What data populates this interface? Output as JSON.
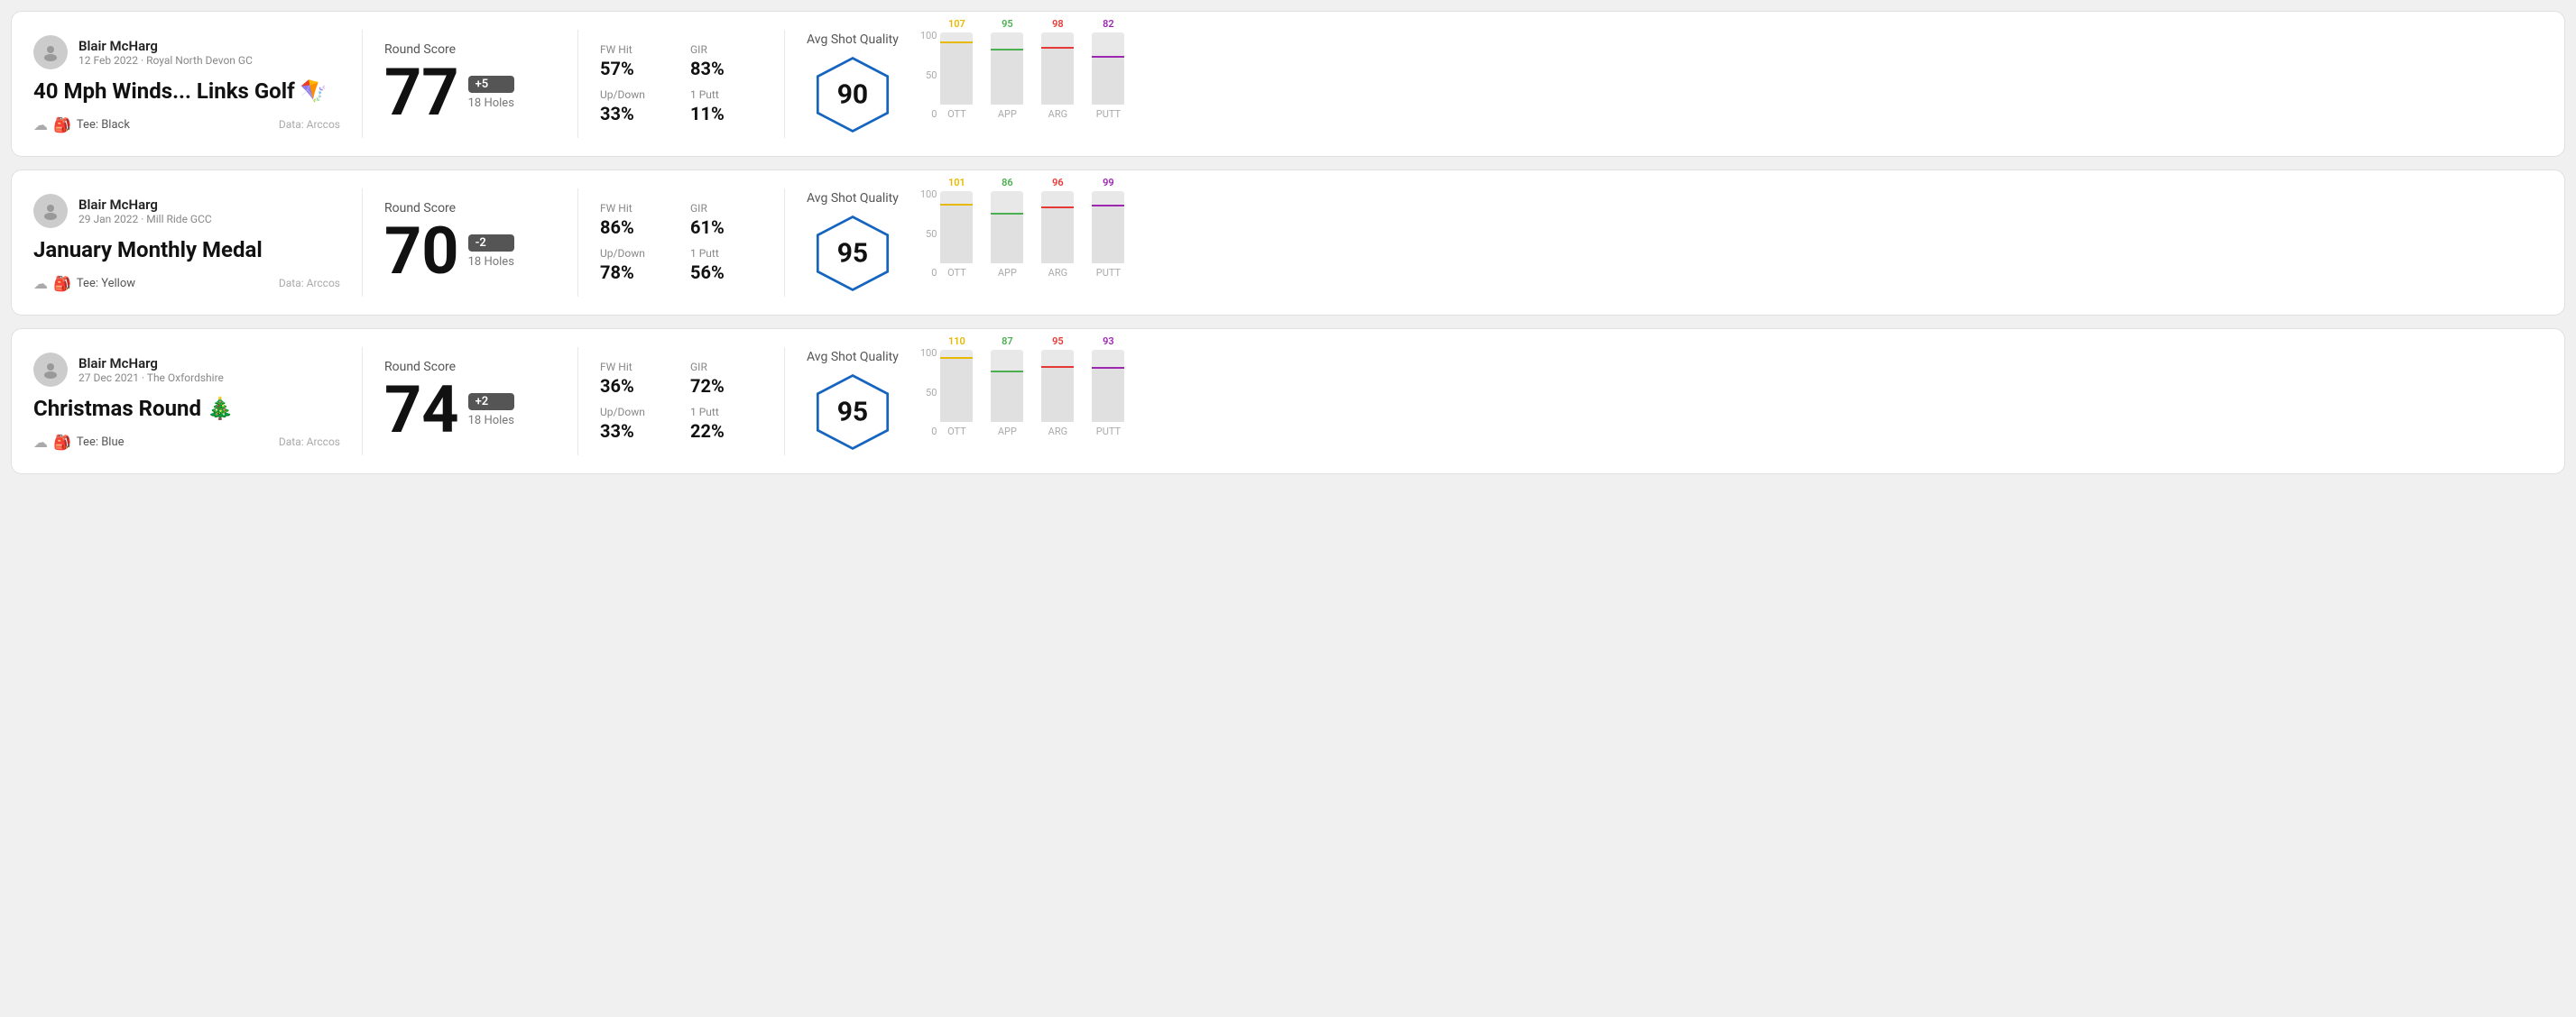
{
  "cards": [
    {
      "id": "card1",
      "user": {
        "name": "Blair McHarg",
        "date": "12 Feb 2022 · Royal North Devon GC"
      },
      "title": "40 Mph Winds... Links Golf 🪁",
      "tee": "Tee: Black",
      "data_source": "Data: Arccos",
      "score": {
        "label": "Round Score",
        "number": "77",
        "badge": "+5",
        "badge_type": "over",
        "holes": "18 Holes"
      },
      "stats": [
        {
          "name": "FW Hit",
          "value": "57%"
        },
        {
          "name": "GIR",
          "value": "83%"
        },
        {
          "name": "Up/Down",
          "value": "33%"
        },
        {
          "name": "1 Putt",
          "value": "11%"
        }
      ],
      "quality": {
        "label": "Avg Shot Quality",
        "score": "90"
      },
      "chart": {
        "bars": [
          {
            "label": "OTT",
            "value": 107,
            "color": "#e6b800",
            "pct": 85
          },
          {
            "label": "APP",
            "value": 95,
            "color": "#4caf50",
            "pct": 75
          },
          {
            "label": "ARG",
            "value": 98,
            "color": "#e53935",
            "pct": 78
          },
          {
            "label": "PUTT",
            "value": 82,
            "color": "#9c27b0",
            "pct": 65
          }
        ]
      }
    },
    {
      "id": "card2",
      "user": {
        "name": "Blair McHarg",
        "date": "29 Jan 2022 · Mill Ride GCC"
      },
      "title": "January Monthly Medal",
      "tee": "Tee: Yellow",
      "data_source": "Data: Arccos",
      "score": {
        "label": "Round Score",
        "number": "70",
        "badge": "-2",
        "badge_type": "under",
        "holes": "18 Holes"
      },
      "stats": [
        {
          "name": "FW Hit",
          "value": "86%"
        },
        {
          "name": "GIR",
          "value": "61%"
        },
        {
          "name": "Up/Down",
          "value": "78%"
        },
        {
          "name": "1 Putt",
          "value": "56%"
        }
      ],
      "quality": {
        "label": "Avg Shot Quality",
        "score": "95"
      },
      "chart": {
        "bars": [
          {
            "label": "OTT",
            "value": 101,
            "color": "#e6b800",
            "pct": 80
          },
          {
            "label": "APP",
            "value": 86,
            "color": "#4caf50",
            "pct": 68
          },
          {
            "label": "ARG",
            "value": 96,
            "color": "#e53935",
            "pct": 76
          },
          {
            "label": "PUTT",
            "value": 99,
            "color": "#9c27b0",
            "pct": 79
          }
        ]
      }
    },
    {
      "id": "card3",
      "user": {
        "name": "Blair McHarg",
        "date": "27 Dec 2021 · The Oxfordshire"
      },
      "title": "Christmas Round 🎄",
      "tee": "Tee: Blue",
      "data_source": "Data: Arccos",
      "score": {
        "label": "Round Score",
        "number": "74",
        "badge": "+2",
        "badge_type": "over",
        "holes": "18 Holes"
      },
      "stats": [
        {
          "name": "FW Hit",
          "value": "36%"
        },
        {
          "name": "GIR",
          "value": "72%"
        },
        {
          "name": "Up/Down",
          "value": "33%"
        },
        {
          "name": "1 Putt",
          "value": "22%"
        }
      ],
      "quality": {
        "label": "Avg Shot Quality",
        "score": "95"
      },
      "chart": {
        "bars": [
          {
            "label": "OTT",
            "value": 110,
            "color": "#e6b800",
            "pct": 88
          },
          {
            "label": "APP",
            "value": 87,
            "color": "#4caf50",
            "pct": 69
          },
          {
            "label": "ARG",
            "value": 95,
            "color": "#e53935",
            "pct": 75
          },
          {
            "label": "PUTT",
            "value": 93,
            "color": "#9c27b0",
            "pct": 74
          }
        ]
      }
    }
  ],
  "chart_y_labels": [
    "100",
    "50",
    "0"
  ]
}
